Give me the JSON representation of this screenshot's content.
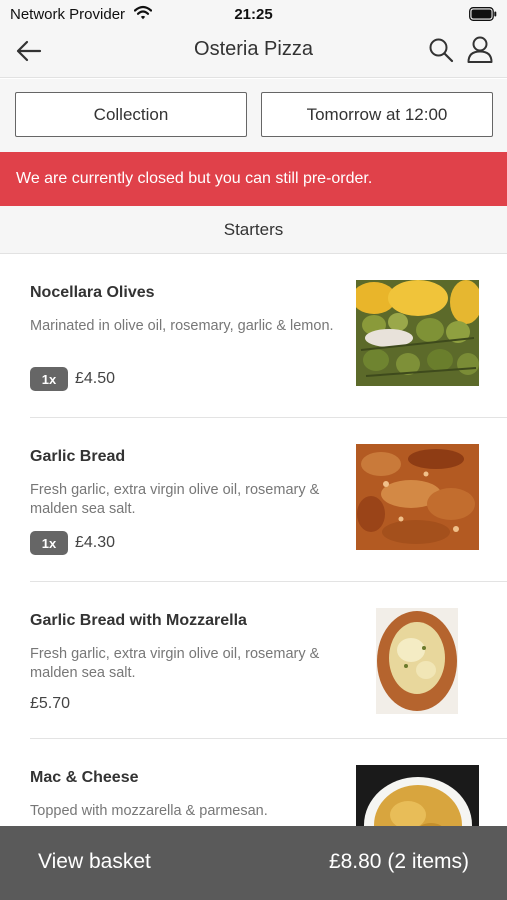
{
  "status_bar": {
    "carrier": "Network Provider",
    "time": "21:25"
  },
  "nav": {
    "title": "Osteria Pizza"
  },
  "options": {
    "collection": "Collection",
    "time": "Tomorrow at 12:00"
  },
  "banner": {
    "text": "We are currently closed but you can still pre-order."
  },
  "section": {
    "title": "Starters"
  },
  "items": [
    {
      "name": "Nocellara Olives",
      "description": "Marinated in olive oil, rosemary, garlic & lemon.",
      "qty": "1x",
      "price": "£4.50"
    },
    {
      "name": "Garlic Bread",
      "description": "Fresh garlic, extra virgin olive oil, rosemary & malden sea salt.",
      "qty": "1x",
      "price": "£4.30"
    },
    {
      "name": "Garlic Bread with Mozzarella",
      "description": "Fresh garlic, extra virgin olive oil, rosemary & malden sea salt.",
      "price": "£5.70"
    },
    {
      "name": "Mac & Cheese",
      "description": "Topped with mozzarella & parmesan."
    }
  ],
  "basket": {
    "label": "View basket",
    "total": "£8.80 (2 items)"
  },
  "colors": {
    "banner": "#e0414a",
    "basket_bar": "#5a5a5a",
    "qty_badge": "#666666"
  },
  "icons": [
    "wifi-icon",
    "battery-icon",
    "back-arrow-icon",
    "search-icon",
    "user-icon"
  ]
}
